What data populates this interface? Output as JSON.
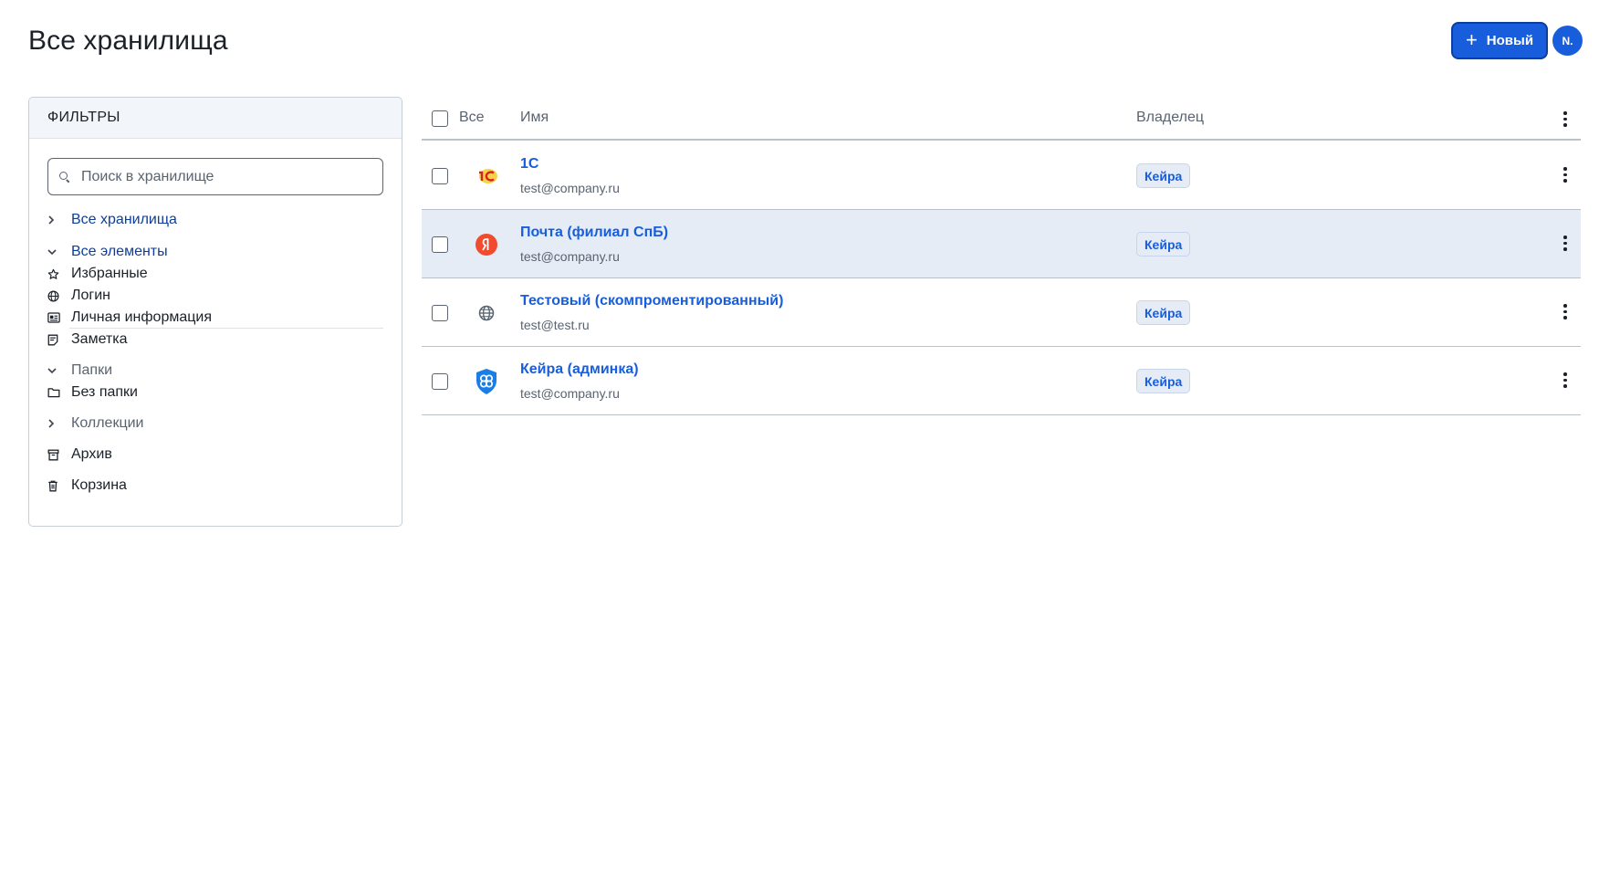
{
  "page": {
    "title": "Все хранилища"
  },
  "header": {
    "new_button_label": "Новый",
    "avatar_initials": "N."
  },
  "filters": {
    "title": "ФИЛЬТРЫ",
    "search_placeholder": "Поиск в хранилище",
    "all_vaults": "Все хранилища",
    "all_items": "Все элементы",
    "types": [
      {
        "label": "Избранные",
        "icon": "star-icon"
      },
      {
        "label": "Логин",
        "icon": "globe-icon"
      },
      {
        "label": "Личная информация",
        "icon": "id-card-icon"
      },
      {
        "label": "Заметка",
        "icon": "note-icon"
      }
    ],
    "folders": "Папки",
    "no_folder": "Без папки",
    "collections": "Коллекции",
    "archive": "Архив",
    "trash": "Корзина"
  },
  "table": {
    "col_all": "Все",
    "col_name": "Имя",
    "col_owner": "Владелец",
    "rows": [
      {
        "name": "1С",
        "subtitle": "test@company.ru",
        "owner": "Кейра",
        "icon": "1c-logo-icon"
      },
      {
        "name": "Почта (филиал СпБ)",
        "subtitle": "test@company.ru",
        "owner": "Кейра",
        "icon": "yandex-logo-icon"
      },
      {
        "name": "Тестовый (скомпроментированный)",
        "subtitle": "test@test.ru",
        "owner": "Кейра",
        "icon": "globe-icon"
      },
      {
        "name": "Кейра (админка)",
        "subtitle": "test@company.ru",
        "owner": "Кейра",
        "icon": "shield-logo-icon"
      }
    ]
  },
  "colors": {
    "accent": "#175ddc",
    "accent_dark": "#0e3e9a",
    "row_highlight": "#e6ecf6"
  }
}
